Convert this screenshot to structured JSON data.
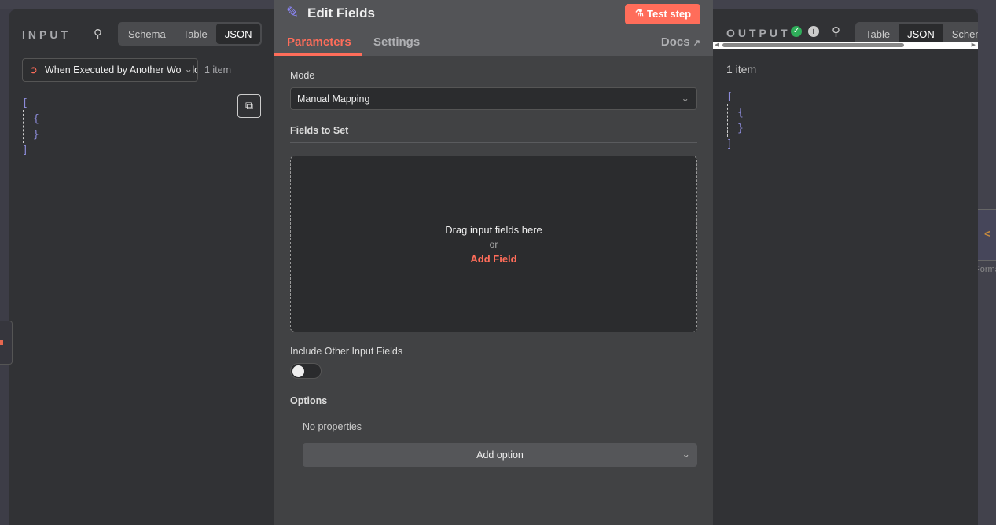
{
  "input": {
    "title": "INPUT",
    "view_tabs": [
      "Schema",
      "Table",
      "JSON"
    ],
    "active_tab": "JSON",
    "trigger_select": "When Executed by Another Workflow",
    "item_count": "1 item",
    "json_lines": [
      "[",
      "{",
      "}",
      "]"
    ]
  },
  "node": {
    "title": "Edit Fields",
    "test_button": "Test step",
    "tabs": [
      "Parameters",
      "Settings"
    ],
    "active_tab": "Parameters",
    "docs_link": "Docs",
    "mode_label": "Mode",
    "mode_value": "Manual Mapping",
    "fields_label": "Fields to Set",
    "drop_text": "Drag input fields here",
    "drop_or": "or",
    "add_field": "Add Field",
    "include_label": "Include Other Input Fields",
    "include_enabled": false,
    "options_label": "Options",
    "no_properties": "No properties",
    "add_option": "Add option"
  },
  "output": {
    "title": "OUTPUT",
    "view_tabs": [
      "Table",
      "JSON",
      "Schema"
    ],
    "active_tab": "JSON",
    "item_count": "1 item",
    "json_lines": [
      "[",
      "{",
      "}",
      "]"
    ]
  },
  "canvas": {
    "node_label_fragment": "Format F"
  },
  "colors": {
    "accent": "#ff6d5a",
    "json": "#8c8bd9",
    "success": "#2fae5a",
    "pencil": "#8e88ff"
  }
}
